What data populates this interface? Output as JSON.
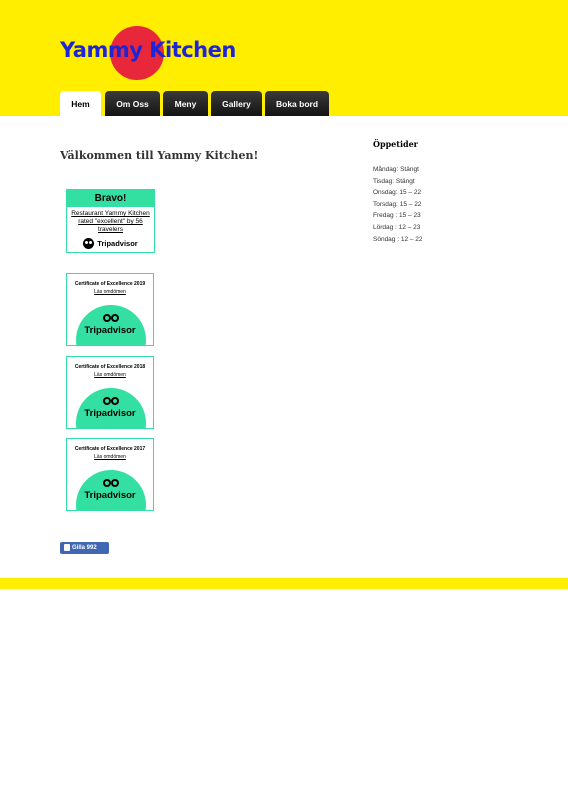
{
  "header": {
    "logo_text": "Yammy Kitchen",
    "colors": {
      "background": "#ffee00",
      "logo_text": "#1e25d6",
      "logo_circle": "#e8283a"
    }
  },
  "nav": {
    "items": [
      {
        "label": "Hem",
        "active": true
      },
      {
        "label": "Om Oss",
        "active": false
      },
      {
        "label": "Meny",
        "active": false
      },
      {
        "label": "Gallery",
        "active": false
      },
      {
        "label": "Boka bord",
        "active": false
      }
    ]
  },
  "main": {
    "welcome": "Välkommen till Yammy Kitchen!",
    "bravo": {
      "title": "Bravo!",
      "message": "Restaurant Yammy Kitchen rated \"excellent\" by 56 travelers",
      "brand": "Tripadvisor",
      "accent": "#34e0a1"
    },
    "certificates": [
      {
        "title": "Certificate of Excellence 2019",
        "link": "Läs omdömen",
        "brand": "Tripadvisor"
      },
      {
        "title": "Certificate of Excellence 2018",
        "link": "Läs omdömen",
        "brand": "Tripadvisor"
      },
      {
        "title": "Certificate of Excellence 2017",
        "link": "Läs omdömen",
        "brand": "Tripadvisor"
      }
    ],
    "facebook": {
      "label": "Gilla 992",
      "color": "#4267b2"
    }
  },
  "sidebar": {
    "title": "Öppetider",
    "hours": [
      "Måndag: Stängt",
      "Tisdag: Stängt",
      "Onsdag: 15 – 22",
      "Torsdag: 15 – 22",
      "Fredag : 15 – 23",
      "Lördag : 12 – 23",
      "Söndag : 12 – 22"
    ]
  }
}
